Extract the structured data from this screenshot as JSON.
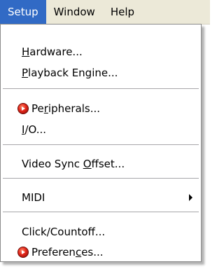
{
  "menubar": {
    "items": [
      {
        "label": "Setup",
        "active": true
      },
      {
        "label": "Window",
        "active": false
      },
      {
        "label": "Help",
        "active": false
      }
    ]
  },
  "menu": {
    "items": [
      {
        "pre": "",
        "ul": "H",
        "post": "ardware...",
        "icon": null
      },
      {
        "pre": "",
        "ul": "P",
        "post": "layback Engine...",
        "icon": null
      },
      {
        "pre": "Pe",
        "ul": "r",
        "post": "ipherals...",
        "icon": "pro-tools-icon"
      },
      {
        "pre": "",
        "ul": "I",
        "post": "/O...",
        "icon": null
      },
      {
        "pre": "Video Sync ",
        "ul": "O",
        "post": "ffset...",
        "icon": null
      },
      {
        "pre": "MIDI",
        "ul": "",
        "post": "",
        "icon": null,
        "submenu": true
      },
      {
        "pre": "Click/Countoff...",
        "ul": "",
        "post": "",
        "icon": null
      },
      {
        "pre": "Preferen",
        "ul": "c",
        "post": "es...",
        "icon": "pro-tools-icon"
      }
    ]
  },
  "colors": {
    "menubar_bg": "#ece9d8",
    "highlight": "#316ac5",
    "menu_bg": "#ffffff",
    "separator": "#a7a6aa"
  }
}
